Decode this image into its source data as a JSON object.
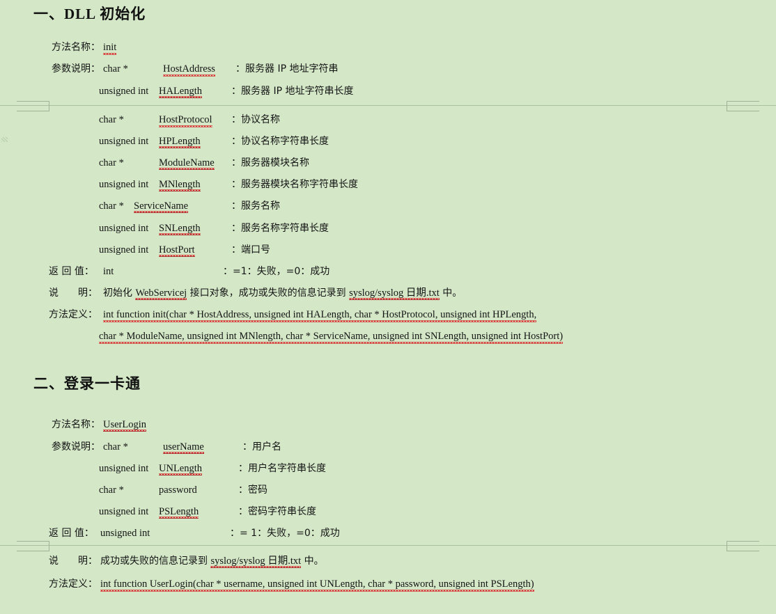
{
  "document": {
    "background_color": "#d4e8c8",
    "sections": [
      {
        "heading": "一、DLL 初始化",
        "fields": {
          "method_name_label": "方法名称：",
          "method_name_value": "init",
          "params_label": "参数说明：",
          "return_label": "返 回 值：",
          "return_value": "int",
          "return_desc": "：=1：失败，=0：成功",
          "note_label": "说　　明：",
          "note_text_1": "初始化 ",
          "note_code": "WebServicej",
          "note_text_2": " 接口对象，成功或失败的信息记录到 ",
          "note_path": "syslog/syslog 日期.txt",
          "note_text_3": " 中。",
          "definition_label": "方法定义：",
          "definition_line1": "int function init(char * HostAddress, unsigned int   HALength, char * HostProtocol, unsigned int   HPLength,",
          "definition_line2": "char * ModuleName, unsigned int   MNlength, char * ServiceName, unsigned int   SNLength, unsigned int   HostPort)"
        },
        "params": [
          {
            "type": "char *",
            "name": "HostAddress",
            "desc": "：服务器 IP 地址字符串"
          },
          {
            "type": "unsigned int",
            "name": "HALength",
            "desc": "：服务器 IP 地址字符串长度"
          },
          {
            "type": "char *",
            "name": "HostProtocol",
            "desc": "：协议名称"
          },
          {
            "type": "unsigned int",
            "name": "HPLength",
            "desc": "：协议名称字符串长度"
          },
          {
            "type": "char *",
            "name": "ModuleName",
            "desc": "：服务器模块名称"
          },
          {
            "type": "unsigned int",
            "name": "MNlength",
            "desc": "：服务器模块名称字符串长度"
          },
          {
            "type": "char *",
            "name": "ServiceName",
            "desc": "：服务名称"
          },
          {
            "type": "unsigned int",
            "name": "SNLength",
            "desc": "：服务名称字符串长度"
          },
          {
            "type": "unsigned int",
            "name": "HostPort",
            "desc": "：端口号"
          }
        ]
      },
      {
        "heading": "二、登录一卡通",
        "fields": {
          "method_name_label": "方法名称：",
          "method_name_value": "UserLogin",
          "params_label": "参数说明：",
          "return_label": "返 回 值：",
          "return_value": "unsigned int",
          "return_desc": "：= 1：失败，=0：成功",
          "note_label": "说　　明：",
          "note_text_1": "成功或失败的信息记录到 ",
          "note_path": "syslog/syslog 日期.txt",
          "note_text_3": " 中。",
          "definition_label": "方法定义：",
          "definition_line1": "int function UserLogin(char * username, unsigned int   UNLength, char * password, unsigned int   PSLength)"
        },
        "params": [
          {
            "type": "char *",
            "name": "userName",
            "desc": "：用户名"
          },
          {
            "type": "unsigned int",
            "name": "UNLength",
            "desc": "：用户名字符串长度"
          },
          {
            "type": "char *",
            "name": "password",
            "desc": "：密码"
          },
          {
            "type": "unsigned int",
            "name": "PSLength",
            "desc": "：密码字符串长度"
          }
        ]
      }
    ]
  }
}
